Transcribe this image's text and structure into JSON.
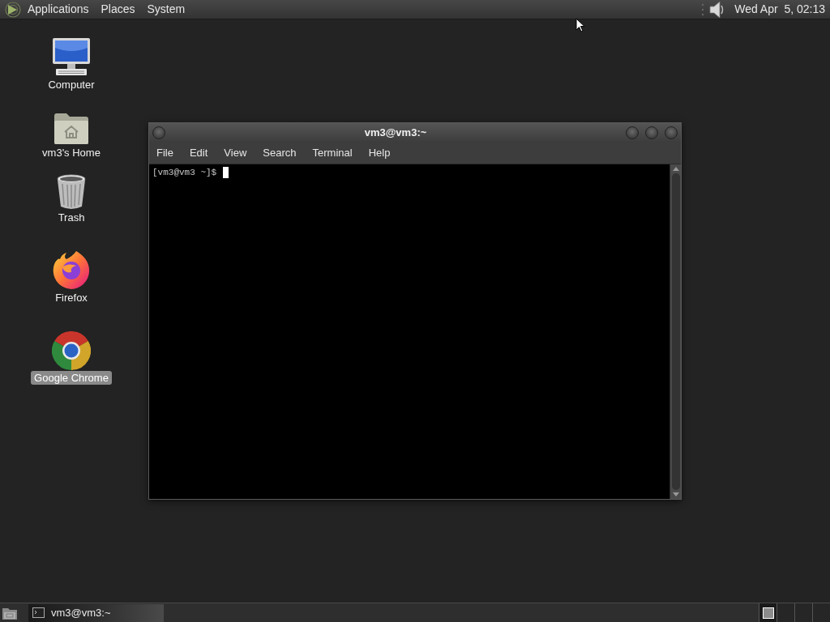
{
  "top_panel": {
    "menus": [
      "Applications",
      "Places",
      "System"
    ],
    "clock": "Wed Apr  5, 02:13"
  },
  "desktop_icons": [
    {
      "label": "Computer",
      "kind": "computer",
      "selected": false
    },
    {
      "label": "vm3's Home",
      "kind": "home",
      "selected": false
    },
    {
      "label": "Trash",
      "kind": "trash",
      "selected": false
    },
    {
      "label": "Firefox",
      "kind": "firefox",
      "selected": false
    },
    {
      "label": "Google Chrome",
      "kind": "chrome",
      "selected": true
    }
  ],
  "terminal_window": {
    "title": "vm3@vm3:~",
    "menus": [
      "File",
      "Edit",
      "View",
      "Search",
      "Terminal",
      "Help"
    ],
    "prompt": "[vm3@vm3 ~]$"
  },
  "bottom_panel": {
    "tasks": [
      {
        "label": "vm3@vm3:~",
        "selected": true
      }
    ],
    "workspaces": [
      {
        "selected": true
      },
      {
        "selected": false
      },
      {
        "selected": false
      },
      {
        "selected": false
      }
    ]
  }
}
